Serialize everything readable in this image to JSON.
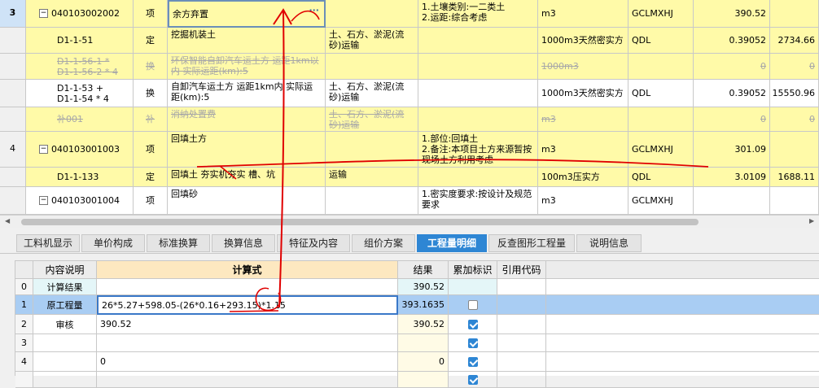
{
  "top_grid": {
    "rows": [
      {
        "idx": "3",
        "code": "040103002002",
        "type": "项",
        "name": "余方弃置",
        "unit_text": "",
        "features": "1.土壤类别:一二类土\n2.运距:综合考虑",
        "unit": "m3",
        "rule": "GCLMXHJ",
        "qty": "390.52",
        "amount": ""
      },
      {
        "idx": "",
        "code": "D1-1-51",
        "type": "定",
        "name": "挖掘机装土",
        "unit_text": "土、石方、淤泥(流砂)运输",
        "features": "",
        "unit": "1000m3天然密实方",
        "rule": "QDL",
        "qty": "0.39052",
        "amount": "2734.66"
      },
      {
        "idx": "",
        "code": "D1-1-56-1 *\nD1-1-56-2 * 4",
        "type": "换",
        "name": "环保智能自卸汽车运土方 运距1km以内  实际运距(km):5",
        "unit_text": "",
        "features": "",
        "unit": "1000m3",
        "rule": "",
        "qty": "0",
        "amount": "0"
      },
      {
        "idx": "",
        "code": "D1-1-53 +\nD1-1-54 * 4",
        "type": "换",
        "name": "自卸汽车运土方 运距1km内  实际运距(km):5",
        "unit_text": "土、石方、淤泥(流砂)运输",
        "features": "",
        "unit": "1000m3天然密实方",
        "rule": "QDL",
        "qty": "0.39052",
        "amount": "15550.96"
      },
      {
        "idx": "",
        "code": "补001",
        "type": "补",
        "name": "消纳处置费",
        "unit_text": "土、石方、淤泥(流砂)运输",
        "features": "",
        "unit": "m3",
        "rule": "",
        "qty": "0",
        "amount": "0"
      },
      {
        "idx": "4",
        "code": "040103001003",
        "type": "项",
        "name": "回填土方",
        "unit_text": "",
        "features": "1.部位:回填土\n2.备注:本项目土方来源暂按现场土方利用考虑",
        "unit": "m3",
        "rule": "GCLMXHJ",
        "qty": "301.09",
        "amount": ""
      },
      {
        "idx": "",
        "code": "D1-1-133",
        "type": "定",
        "name": "回填土 夯实机夯实 槽、坑",
        "unit_text": "运输",
        "features": "",
        "unit": "100m3压实方",
        "rule": "QDL",
        "qty": "3.0109",
        "amount": "1688.11"
      },
      {
        "idx": "",
        "code": "040103001004",
        "type": "项",
        "name": "回填砂",
        "unit_text": "",
        "features": "1.密实度要求:按设计及规范要求",
        "unit": "m3",
        "rule": "GCLMXHJ",
        "qty": "",
        "amount": ""
      }
    ]
  },
  "tabs": [
    "工料机显示",
    "单价构成",
    "标准换算",
    "换算信息",
    "特征及内容",
    "组价方案",
    "工程量明细",
    "反查图形工程量",
    "说明信息"
  ],
  "active_tab": "工程量明细",
  "bottom_grid": {
    "headers": {
      "desc": "内容说明",
      "calc": "计算式",
      "result": "结果",
      "flag": "累加标识",
      "ref": "引用代码"
    },
    "rows": [
      {
        "idx": "0",
        "desc": "计算结果",
        "calc": "",
        "result": "390.52",
        "flag": "none"
      },
      {
        "idx": "1",
        "desc": "原工程量",
        "calc": "26*5.27+598.05-(26*0.16+293.15)*1.15",
        "result": "393.1635",
        "flag": "unchecked"
      },
      {
        "idx": "2",
        "desc": "审核",
        "calc": "390.52",
        "result": "390.52",
        "flag": "checked"
      },
      {
        "idx": "3",
        "desc": "",
        "calc": "",
        "result": "",
        "flag": "checked"
      },
      {
        "idx": "4",
        "desc": "",
        "calc": "0",
        "result": "0",
        "flag": "checked"
      },
      {
        "idx": "",
        "desc": "",
        "calc": "",
        "result": "",
        "flag": "checked"
      }
    ]
  },
  "colors": {
    "accent": "#2e86d4",
    "yellow_row": "#fffaa8",
    "annotation": "#e00000"
  }
}
